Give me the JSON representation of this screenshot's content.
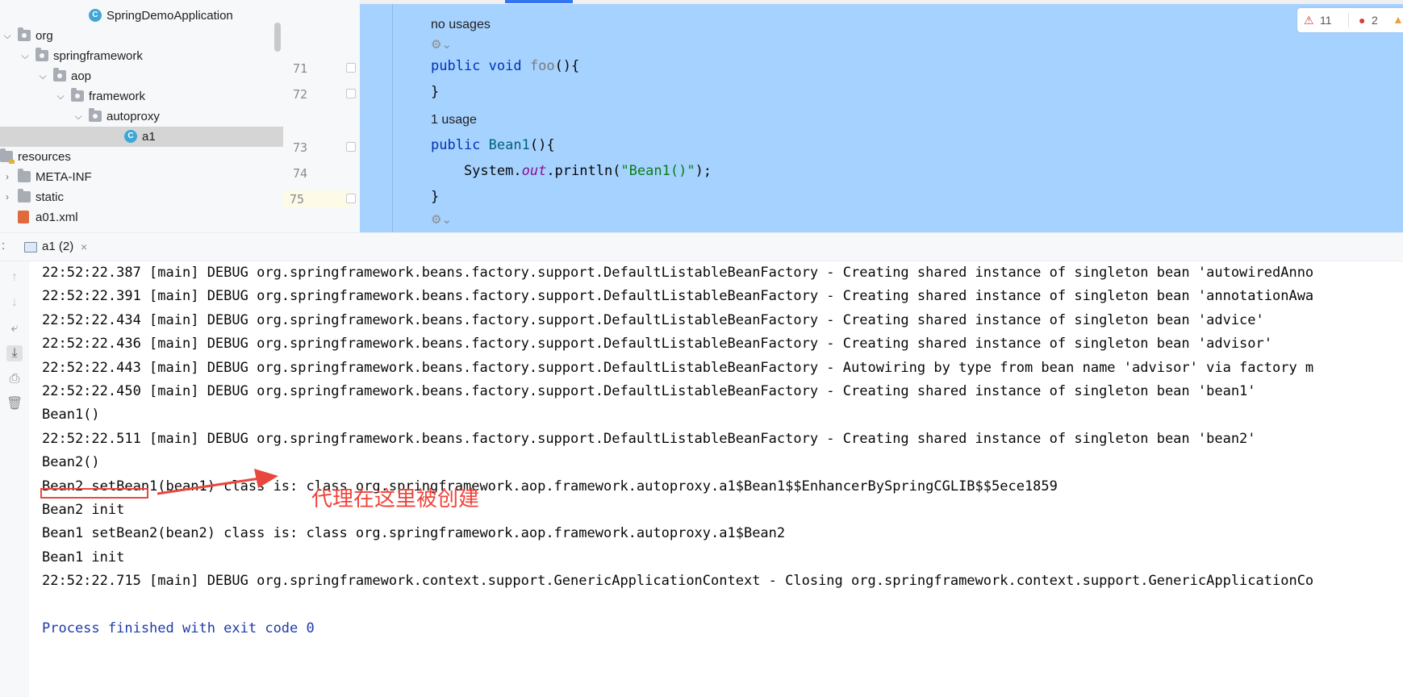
{
  "project_tree": {
    "items": [
      {
        "label": "SpringDemoApplication",
        "icon": "class-icon",
        "depth": 6,
        "expanded": null,
        "selected": false
      },
      {
        "label": "org",
        "icon": "package-icon",
        "depth": 2,
        "expanded": true,
        "selected": false
      },
      {
        "label": "springframework",
        "icon": "package-icon",
        "depth": 3,
        "expanded": true,
        "selected": false
      },
      {
        "label": "aop",
        "icon": "package-icon",
        "depth": 4,
        "expanded": true,
        "selected": false
      },
      {
        "label": "framework",
        "icon": "package-icon",
        "depth": 5,
        "expanded": true,
        "selected": false
      },
      {
        "label": "autoproxy",
        "icon": "package-icon",
        "depth": 6,
        "expanded": true,
        "selected": false
      },
      {
        "label": "a1",
        "icon": "class-icon",
        "depth": 8,
        "expanded": null,
        "selected": true
      },
      {
        "label": "resources",
        "icon": "resources-folder-icon",
        "depth": 1,
        "expanded": true,
        "selected": false
      },
      {
        "label": "META-INF",
        "icon": "folder-icon",
        "depth": 2,
        "expanded": false,
        "selected": false
      },
      {
        "label": "static",
        "icon": "folder-icon",
        "depth": 2,
        "expanded": false,
        "selected": false
      },
      {
        "label": "a01.xml",
        "icon": "xml-file-icon",
        "depth": 2,
        "expanded": null,
        "selected": false
      }
    ]
  },
  "editor": {
    "inspections": {
      "warnings": "11",
      "errors": "2"
    },
    "lines": [
      {
        "type": "hint",
        "text": "no usages"
      },
      {
        "type": "hint-icon"
      },
      {
        "type": "code",
        "number": "71",
        "tokens": [
          {
            "t": "public ",
            "c": "kw"
          },
          {
            "t": "void ",
            "c": "kw"
          },
          {
            "t": "foo",
            "c": "fn-unused"
          },
          {
            "t": "(){",
            "c": ""
          }
        ]
      },
      {
        "type": "code",
        "number": "72",
        "tokens": [
          {
            "t": "}",
            "c": ""
          }
        ]
      },
      {
        "type": "hint",
        "text": "1 usage"
      },
      {
        "type": "code",
        "number": "73",
        "tokens": [
          {
            "t": "public ",
            "c": "kw"
          },
          {
            "t": "Bean1",
            "c": "fn"
          },
          {
            "t": "(){",
            "c": ""
          }
        ]
      },
      {
        "type": "code",
        "number": "74",
        "tokens": [
          {
            "t": "    System.",
            "c": ""
          },
          {
            "t": "out",
            "c": "fld"
          },
          {
            "t": ".println(",
            "c": ""
          },
          {
            "t": "\"Bean1()\"",
            "c": "str"
          },
          {
            "t": ");",
            "c": ""
          }
        ]
      },
      {
        "type": "code",
        "number": "75",
        "tokens": [
          {
            "t": "}",
            "c": ""
          }
        ],
        "current": true
      },
      {
        "type": "hint-icon"
      }
    ]
  },
  "run_panel": {
    "tab_label": "a1 (2)",
    "close_glyph": "×"
  },
  "console": {
    "lines": [
      "22:52:22.387 [main] DEBUG org.springframework.beans.factory.support.DefaultListableBeanFactory - Creating shared instance of singleton bean 'autowiredAnno",
      "22:52:22.391 [main] DEBUG org.springframework.beans.factory.support.DefaultListableBeanFactory - Creating shared instance of singleton bean 'annotationAwa",
      "22:52:22.434 [main] DEBUG org.springframework.beans.factory.support.DefaultListableBeanFactory - Creating shared instance of singleton bean 'advice'",
      "22:52:22.436 [main] DEBUG org.springframework.beans.factory.support.DefaultListableBeanFactory - Creating shared instance of singleton bean 'advisor'",
      "22:52:22.443 [main] DEBUG org.springframework.beans.factory.support.DefaultListableBeanFactory - Autowiring by type from bean name 'advisor' via factory m",
      "22:52:22.450 [main] DEBUG org.springframework.beans.factory.support.DefaultListableBeanFactory - Creating shared instance of singleton bean 'bean1'",
      "Bean1()",
      "22:52:22.511 [main] DEBUG org.springframework.beans.factory.support.DefaultListableBeanFactory - Creating shared instance of singleton bean 'bean2'",
      "Bean2()",
      "Bean2 setBean1(bean1) class is: class org.springframework.aop.framework.autoproxy.a1$Bean1$$EnhancerBySpringCGLIB$$5ece1859",
      "Bean2 init",
      "Bean1 setBean2(bean2) class is: class org.springframework.aop.framework.autoproxy.a1$Bean2",
      "Bean1 init",
      "22:52:22.715 [main] DEBUG org.springframework.context.support.GenericApplicationContext - Closing org.springframework.context.support.GenericApplicationCo",
      "",
      "Process finished with exit code 0"
    ]
  },
  "annotation": {
    "text": "代理在这里被创建",
    "color": "#f0443a"
  }
}
